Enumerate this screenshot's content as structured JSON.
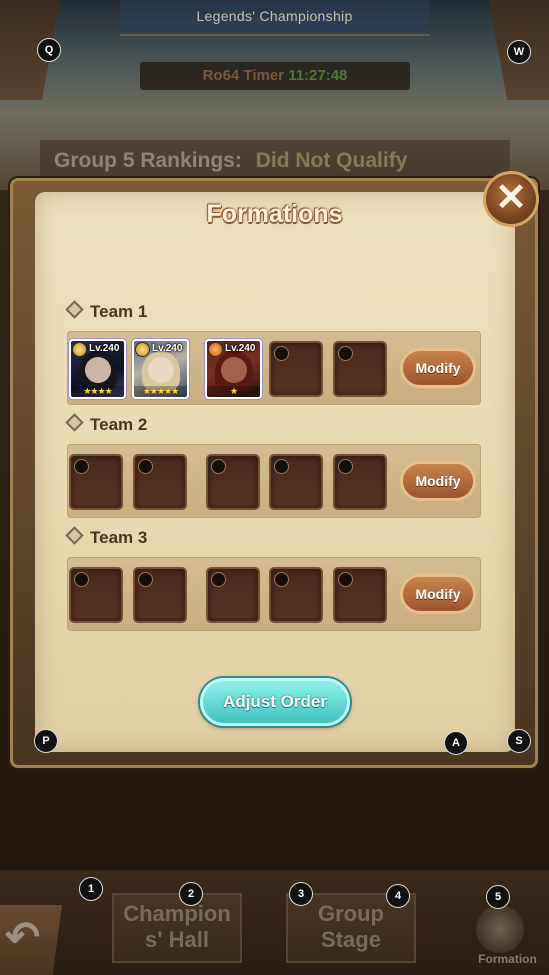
{
  "header": {
    "title": "Legends' Championship",
    "timer_label": "Ro64 Timer",
    "timer_value": "11:27:48",
    "ranking_label": "Group 5 Rankings:",
    "ranking_value": "Did Not Qualify"
  },
  "panel": {
    "title": "Formations",
    "close_icon": "close-icon",
    "teams": [
      {
        "label": "Team 1",
        "modify_label": "Modify",
        "heroes": [
          {
            "level": "Lv.240",
            "stars": "★★★★"
          },
          {
            "level": "Lv.240",
            "stars": "★★★★★"
          },
          {
            "level": "Lv.240",
            "stars": "★"
          }
        ],
        "empty_slots": 2
      },
      {
        "label": "Team 2",
        "modify_label": "Modify",
        "heroes": [],
        "empty_slots": 5
      },
      {
        "label": "Team 3",
        "modify_label": "Modify",
        "heroes": [],
        "empty_slots": 5
      }
    ],
    "adjust_label": "Adjust Order"
  },
  "nav": {
    "champions_hall": "Champion s' Hall",
    "champions_hall_line1": "Champion",
    "champions_hall_line2": "s' Hall",
    "group_stage_line1": "Group",
    "group_stage_line2": "Stage",
    "formation": "Formation"
  },
  "hints": {
    "q": "Q",
    "w": "W",
    "p": "P",
    "a": "A",
    "s": "S",
    "n1": "1",
    "n2": "2",
    "n3": "3",
    "n4": "4",
    "n5": "5"
  },
  "colors": {
    "timer": "#4e7a34",
    "adjust_button": "#3fc3c1",
    "modify_button": "#9a5530"
  }
}
